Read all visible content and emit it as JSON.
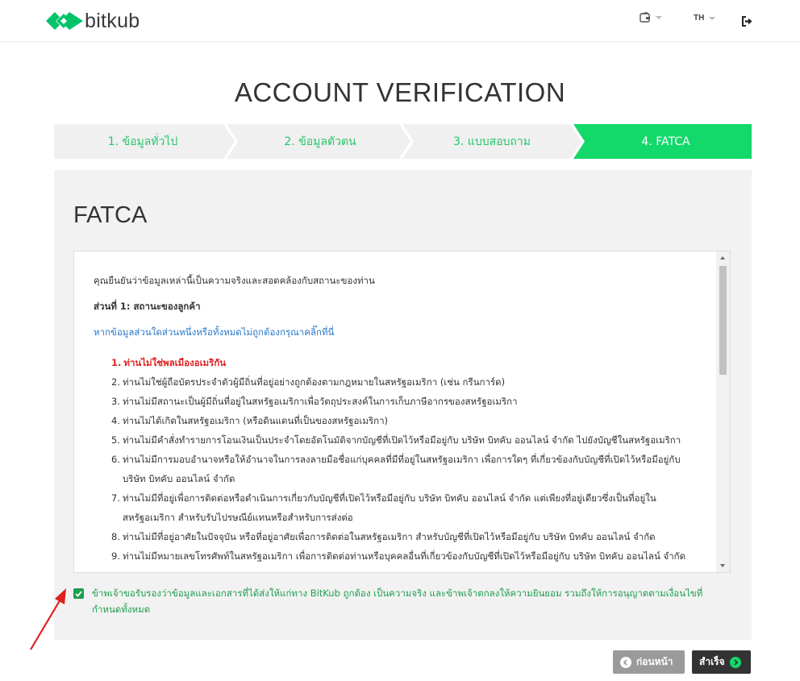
{
  "header": {
    "brand": "bitkub",
    "language": "TH",
    "icons": {
      "wallet": "wallet-icon",
      "logout": "logout-icon"
    },
    "brand_color": "#00c36a"
  },
  "page_title": "ACCOUNT VERIFICATION",
  "stepper": {
    "steps": [
      {
        "label": "1. ข้อมูลทั่วไป",
        "active": false
      },
      {
        "label": "2. ข้อมูลตัวตน",
        "active": false
      },
      {
        "label": "3. แบบสอบถาม",
        "active": false
      },
      {
        "label": "4. FATCA",
        "active": true
      }
    ],
    "active_color": "#12d96a",
    "inactive_color": "#f0f0f0"
  },
  "panel": {
    "title": "FATCA",
    "terms": {
      "intro": "คุณยืนยันว่าข้อมูลเหล่านี้เป็นความจริงและสอดคล้องกับสถานะของท่าน",
      "section_title": "ส่วนที่ 1: สถานะของลูกค้า",
      "link_text": "หากข้อมูลส่วนใดส่วนหนึ่งหรือทั้งหมดไม่ถูกต้องกรุณาคลิ๊กที่นี่",
      "items": [
        {
          "n": "1.",
          "text": "ท่านไม่ใช่พลเมืองอเมริกัน"
        },
        {
          "n": "2.",
          "text": "ท่านไม่ใช่ผู้ถือบัตรประจำตัวผู้มีถิ่นที่อยู่อย่างถูกต้องตามกฎหมายในสหรัฐอเมริกา (เช่น กรีนการ์ด)"
        },
        {
          "n": "3.",
          "text": "ท่านไม่มีสถานะเป็นผู้มีถิ่นที่อยู่ในสหรัฐอเมริกาเพื่อวัตถุประสงค์ในการเก็บภาษีอากรของสหรัฐอเมริกา"
        },
        {
          "n": "4.",
          "text": "ท่านไม่ได้เกิดในสหรัฐอเมริกา (หรือดินแดนที่เป็นของสหรัฐอเมริกา)"
        },
        {
          "n": "5.",
          "text": "ท่านไม่มีคำสั่งทำรายการโอนเงินเป็นประจำโดยอัตโนมัติจากบัญชีที่เปิดไว้หรือมีอยู่กับ บริษัท บิทคับ ออนไลน์ จำกัด ไปยังบัญชีในสหรัฐอเมริกา"
        },
        {
          "n": "6.",
          "text": "ท่านไม่มีการมอบอำนาจหรือให้อำนาจในการลงลายมือชื่อแก่บุคคลที่มีที่อยู่ในสหรัฐอเมริกา เพื่อการใดๆ ที่เกี่ยวข้องกับบัญชีที่เปิดไว้หรือมีอยู่กับ บริษัท บิทคับ ออนไลน์ จำกัด"
        },
        {
          "n": "7.",
          "text": "ท่านไม่มีที่อยู่เพื่อการติดต่อหรือดำเนินการเกี่ยวกับบัญชีที่เปิดไว้หรือมีอยู่กับ บริษัท บิทคับ ออนไลน์ จำกัด แต่เพียงที่อยู่เดียวซึ่งเป็นที่อยู่ในสหรัฐอเมริกา สำหรับรับไปรษณีย์แทนหรือสำหรับการส่งต่อ"
        },
        {
          "n": "8.",
          "text": "ท่านไม่มีที่อยู่อาศัยในปัจจุบัน หรือที่อยู่อาศัยเพื่อการติดต่อในสหรัฐอเมริกา สำหรับบัญชีที่เปิดไว้หรือมีอยู่กับ บริษัท บิทคับ ออนไลน์ จำกัด"
        },
        {
          "n": "9.",
          "text": "ท่านไม่มีหมายเลขโทรศัพท์ในสหรัฐอเมริกา เพื่อการติดต่อท่านหรือบุคคลอื่นที่เกี่ยวข้องกับบัญชีที่เปิดไว้หรือมีอยู่กับ บริษัท บิทคับ ออนไลน์ จำกัด"
        }
      ]
    },
    "consent": {
      "checked": true,
      "text": "ข้าพเจ้าขอรับรองว่าข้อมูลและเอกสารที่ได้ส่งให้แก่ทาง BitKub ถูกต้อง เป็นความจริง และข้าพเจ้าตกลงให้ความยินยอม รวมถึงให้การอนุญาตตามเงื่อนไขที่กำหนดทั้งหมด"
    }
  },
  "buttons": {
    "back": "ก่อนหน้า",
    "done": "สำเร็จ"
  }
}
